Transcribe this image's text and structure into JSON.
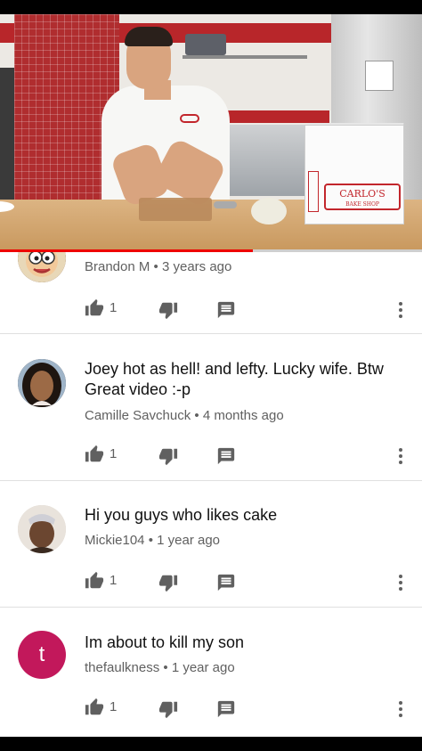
{
  "video": {
    "progress_percent": 60,
    "colors": {
      "progress": "#ee0000",
      "track": "#cfcfcf"
    },
    "box_logo": "CARLO'S",
    "box_logo_sub": "BAKE SHOP"
  },
  "comments": [
    {
      "text": "",
      "author": "Brandon M",
      "age": "3 years ago",
      "likes": "1",
      "avatar": "cartoon-face"
    },
    {
      "text": "Joey hot as hell! and lefty. Lucky wife. Btw Great video :-p",
      "author": "Camille Savchuck",
      "age": "4 months ago",
      "likes": "1",
      "avatar": "photo-woman"
    },
    {
      "text": "Hi you guys who likes cake",
      "author": "Mickie104",
      "age": "1 year ago",
      "likes": "1",
      "avatar": "photo-child"
    },
    {
      "text": "Im about to kill my son",
      "author": "thefaulkness",
      "age": "1 year ago",
      "likes": "1",
      "avatar": "letter",
      "avatar_letter": "t",
      "avatar_color": "#c2185b"
    }
  ],
  "separator": " • ",
  "icons": {
    "like": "thumbs-up-icon",
    "dislike": "thumbs-down-icon",
    "reply": "comment-icon",
    "menu": "more-vertical-icon"
  }
}
